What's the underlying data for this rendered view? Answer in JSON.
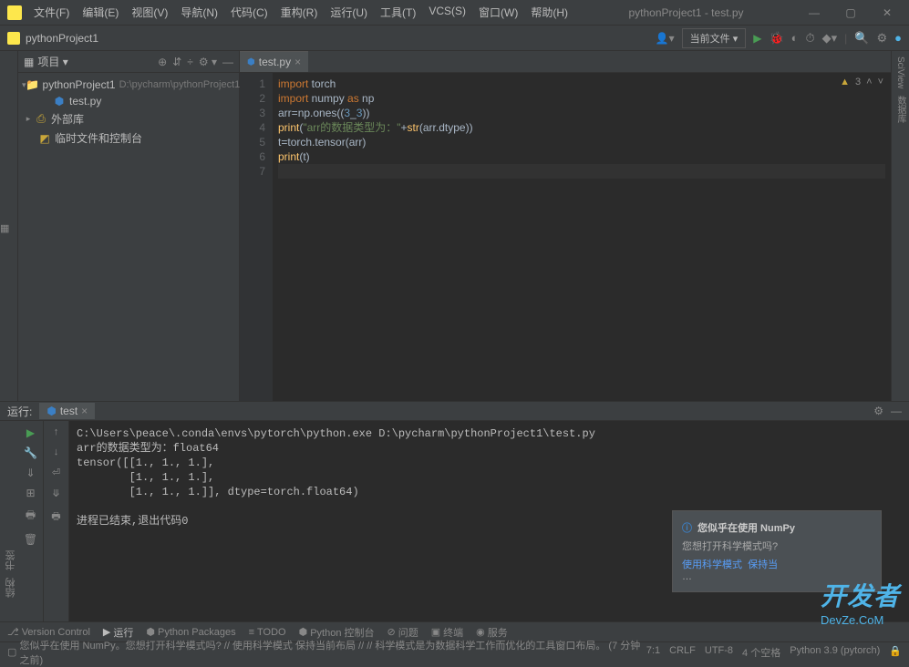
{
  "window": {
    "title": "pythonProject1 - test.py"
  },
  "menu": [
    "文件(F)",
    "编辑(E)",
    "视图(V)",
    "导航(N)",
    "代码(C)",
    "重构(R)",
    "运行(U)",
    "工具(T)",
    "VCS(S)",
    "窗口(W)",
    "帮助(H)"
  ],
  "breadcrumb": "pythonProject1",
  "runconfig": "当前文件",
  "project_panel": {
    "title": "项目",
    "root_name": "pythonProject1",
    "root_path": "D:\\pycharm\\pythonProject1",
    "file": "test.py",
    "external": "外部库",
    "scratch": "临时文件和控制台"
  },
  "editor": {
    "tab": "test.py",
    "warnings": "3",
    "lines": [
      {
        "n": "1",
        "tokens": [
          [
            "kw",
            "import"
          ],
          [
            "op",
            " torch"
          ]
        ]
      },
      {
        "n": "2",
        "tokens": [
          [
            "kw",
            "import"
          ],
          [
            "op",
            " numpy "
          ],
          [
            "kw",
            "as"
          ],
          [
            "op",
            " np"
          ]
        ]
      },
      {
        "n": "3",
        "tokens": [
          [
            "op",
            "arr"
          ],
          [
            "op",
            "="
          ],
          [
            "op",
            "np.ones(("
          ],
          [
            "num",
            "3"
          ],
          [
            "op",
            "_"
          ],
          [
            "num",
            "3"
          ],
          [
            "op",
            "))"
          ]
        ]
      },
      {
        "n": "4",
        "tokens": [
          [
            "fn",
            "print"
          ],
          [
            "op",
            "("
          ],
          [
            "str",
            "\"arr的数据类型为：\""
          ],
          [
            "op",
            "+"
          ],
          [
            "fn",
            "str"
          ],
          [
            "op",
            "(arr.dtype))"
          ]
        ]
      },
      {
        "n": "5",
        "tokens": [
          [
            "op",
            "t"
          ],
          [
            "op",
            "="
          ],
          [
            "op",
            "torch.tensor(arr)"
          ]
        ]
      },
      {
        "n": "6",
        "tokens": [
          [
            "fn",
            "print"
          ],
          [
            "op",
            "(t)"
          ]
        ]
      },
      {
        "n": "7",
        "tokens": []
      }
    ]
  },
  "console": {
    "label": "运行:",
    "tab": "test",
    "output": "C:\\Users\\peace\\.conda\\envs\\pytorch\\python.exe D:\\pycharm\\pythonProject1\\test.py\narr的数据类型为：float64\ntensor([[1., 1., 1.],\n        [1., 1., 1.],\n        [1., 1., 1.]], dtype=torch.float64)\n\n进程已结束,退出代码0"
  },
  "bottom_tabs": [
    "Version Control",
    "运行",
    "Python Packages",
    "TODO",
    "Python 控制台",
    "问题",
    "终端",
    "服务"
  ],
  "statusbar": {
    "msg": "您似乎在使用 NumPy。您想打开科学模式吗? // 使用科学模式  保持当前布局 // // 科学模式是为数据科学工作而优化的工具窗口布局。 (7 分钟 之前)",
    "pos": "7:1",
    "crlf": "CRLF",
    "enc": "UTF-8",
    "indent": "4 个空格",
    "interp": "Python 3.9 (pytorch)"
  },
  "notification": {
    "title": "您似乎在使用 NumPy",
    "body": "您想打开科学模式吗?",
    "link1": "使用科学模式",
    "link2": "保持当"
  },
  "side_left": [
    "结构",
    "书签"
  ],
  "side_right": [
    "SciView",
    "数据库"
  ],
  "watermark": "开发者",
  "watermark_sub": "DevZe.CoM"
}
